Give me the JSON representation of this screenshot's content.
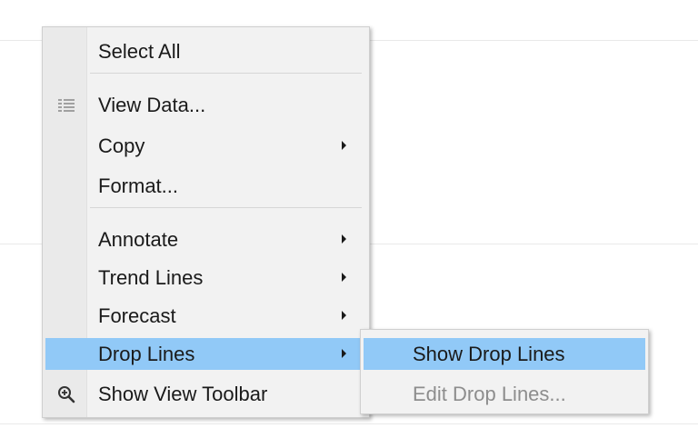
{
  "context_menu": {
    "items": [
      {
        "label": "Select All"
      },
      {
        "label": "View Data...",
        "icon": "table-icon"
      },
      {
        "label": "Copy",
        "submenu": true
      },
      {
        "label": "Format..."
      },
      {
        "label": "Annotate",
        "submenu": true
      },
      {
        "label": "Trend Lines",
        "submenu": true
      },
      {
        "label": "Forecast",
        "submenu": true
      },
      {
        "label": "Drop Lines",
        "submenu": true,
        "highlighted": true
      },
      {
        "label": "Show View Toolbar",
        "icon": "zoom-in-icon"
      }
    ]
  },
  "drop_lines_submenu": {
    "items": [
      {
        "label": "Show Drop Lines",
        "highlighted": true
      },
      {
        "label": "Edit Drop Lines...",
        "disabled": true
      }
    ]
  },
  "colors": {
    "highlight": "#91c9f7",
    "menu_background": "#f2f2f2",
    "disabled_text": "#8d8d8d"
  }
}
